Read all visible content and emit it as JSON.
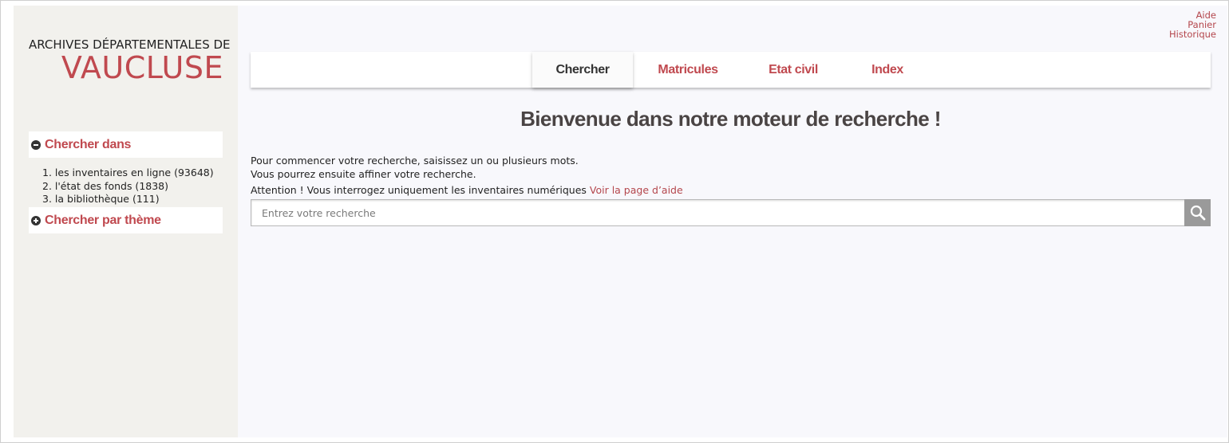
{
  "logo": {
    "line1": "ARCHIVES DÉPARTEMENTALES DE",
    "line2": "VAUCLUSE",
    "accent_color": "#c0494f"
  },
  "sidebar": {
    "panels": [
      {
        "label": "Chercher dans",
        "icon": "minus-circle-icon",
        "expanded": true
      },
      {
        "label": "Chercher par thème",
        "icon": "plus-circle-icon",
        "expanded": false
      }
    ],
    "sources": [
      "1. les inventaires en ligne (93648)",
      "2. l'état des fonds (1838)",
      "3. la bibliothèque (111)"
    ]
  },
  "top_links": [
    "Aide",
    "Panier",
    "Historique"
  ],
  "nav": {
    "tabs": [
      {
        "label": "Chercher",
        "active": true
      },
      {
        "label": "Matricules",
        "active": false
      },
      {
        "label": "Etat civil",
        "active": false
      },
      {
        "label": "Index",
        "active": false
      }
    ]
  },
  "main": {
    "headline": "Bienvenue dans notre moteur de recherche !",
    "intro_line1": "Pour commencer votre recherche, saisissez un ou plusieurs mots.",
    "intro_line2": "Vous pourrez ensuite affiner votre recherche.",
    "warning_text": "Attention ! Vous interrogez uniquement les inventaires numériques",
    "help_link": "Voir la page d’aide"
  },
  "search": {
    "placeholder": "Entrez votre recherche",
    "value": "",
    "button_icon": "search-icon"
  }
}
